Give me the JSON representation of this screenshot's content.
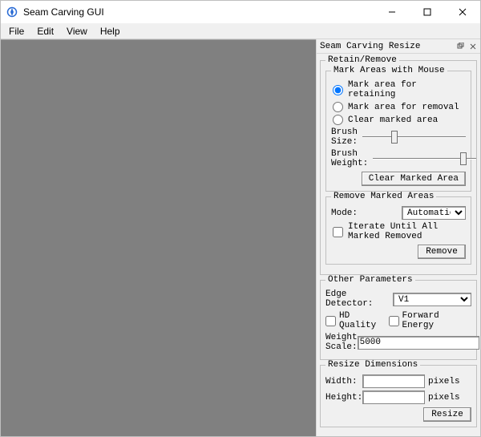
{
  "window": {
    "title": "Seam Carving GUI"
  },
  "menu": {
    "file": "File",
    "edit": "Edit",
    "view": "View",
    "help": "Help"
  },
  "dock": {
    "title": "Seam Carving Resize"
  },
  "retain_remove": {
    "legend": "Retain/Remove",
    "mark_areas": {
      "legend": "Mark Areas with Mouse",
      "radio_retain": "Mark area for retaining",
      "radio_remove": "Mark area for removal",
      "radio_clear": "Clear marked area",
      "brush_size_label": "Brush Size:",
      "brush_size": 30,
      "brush_weight_label": "Brush Weight:",
      "brush_weight": 90,
      "clear_btn": "Clear Marked Area"
    },
    "remove_marked": {
      "legend": "Remove Marked Areas",
      "mode_label": "Mode:",
      "mode_value": "Automatic",
      "iterate_label": "Iterate Until All Marked Removed",
      "remove_btn": "Remove"
    }
  },
  "other": {
    "legend": "Other Parameters",
    "edge_label": "Edge Detector:",
    "edge_value": "V1",
    "hd_label": "HD Quality",
    "forward_label": "Forward Energy",
    "weight_scale_label": "Weight Scale:",
    "weight_scale_value": "5000"
  },
  "resize": {
    "legend": "Resize Dimensions",
    "width_label": "Width:",
    "height_label": "Height:",
    "width_value": "",
    "height_value": "",
    "pixels_suffix": "pixels",
    "resize_btn": "Resize"
  }
}
